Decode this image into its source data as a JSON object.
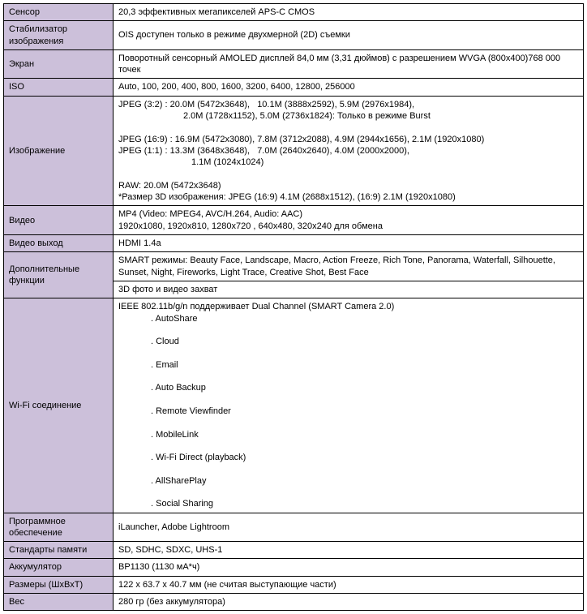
{
  "rows": [
    {
      "label": "Сенсор",
      "value": "20,3 эффективных мегапикселей APS-C CMOS"
    },
    {
      "label": "Стабилизатор изображения",
      "value": "OIS доступен только в режиме двухмерной (2D) съемки"
    },
    {
      "label": "Экран",
      "value": "Поворотный сенсорный AMOLED дисплей 84,0 мм (3,31 дюймов) с разрешением WVGA (800x400)768 000 точек"
    },
    {
      "label": "ISO",
      "value": "Auto, 100, 200, 400, 800, 1600, 3200, 6400, 12800, 256000"
    },
    {
      "label": "Изображение",
      "lines": [
        "JPEG (3:2) : 20.0M (5472x3648),&nbsp;&nbsp;&nbsp;10.1M (3888x2592), 5.9M (2976x1984),",
        "<span class=\"indent2\">2.0M (1728x1152), 5.0M (2736x1824): Только в режиме Burst</span>",
        "JPEG (16:9) : 16.9M (5472x3080), 7.8M (3712x2088), 4.9M (2944x1656), 2.1M (1920x1080)",
        "JPEG (1:1) : 13.3M (3648x3648),&nbsp;&nbsp;&nbsp;7.0M (2640x2640), 4.0M (2000x2000),",
        "<span class=\"indent3\">1.1M (1024x1024)</span>",
        "RAW: 20.0M (5472x3648)",
        "*Размер 3D изображения: JPEG (16:9) 4.1M (2688x1512), (16:9) 2.1M (1920x1080)"
      ]
    },
    {
      "label": "Видео",
      "lines": [
        "MP4 (Video: MPEG4, AVC/H.264, Audio: AAC)",
        "1920x1080, 1920x810, 1280x720 , 640x480, 320x240 для обмена"
      ]
    },
    {
      "label": "Видео выход",
      "value": "HDMI 1.4a"
    },
    {
      "label": "Дополнительные функции",
      "cells": [
        "SMART режимы: Beauty Face, Landscape, Macro, Action Freeze, Rich Tone, Panorama, Waterfall, Silhouette, Sunset, Night, Fireworks, Light Trace, Creative Shot, Best Face",
        "3D фото и видео захват"
      ]
    },
    {
      "label": "Wi-Fi соединение",
      "lines": [
        "IEEE 802.11b/g/n поддерживает Dual Channel (SMART Camera 2.0)",
        "<span class=\"indent\">. AutoShare</span>",
        "<span class=\"indent\">. Cloud</span>",
        "<span class=\"indent\">. Email</span>",
        "<span class=\"indent\">. Auto Backup</span>",
        "<span class=\"indent\">. Remote Viewfinder</span>",
        "<span class=\"indent\">. MobileLink</span>",
        "<span class=\"indent\">. Wi-Fi Direct (playback)</span>",
        "<span class=\"indent\">. AllSharePlay</span>",
        "<span class=\"indent\">. Social Sharing</span>"
      ]
    },
    {
      "label": "Программное обеспечение",
      "value": "iLauncher, Adobe Lightroom"
    },
    {
      "label": "Стандарты памяти",
      "value": "SD, SDHC, SDXC, UHS-1"
    },
    {
      "label": "Аккумулятор",
      "value": "BP1130 (1130 мА*ч)"
    },
    {
      "label": "Размеры (ШхВхТ)",
      "value": "122 x 63.7 x 40.7 мм (не считая выступающие части)"
    },
    {
      "label": "Вес",
      "value": "280 гр (без аккумулятора)"
    }
  ]
}
